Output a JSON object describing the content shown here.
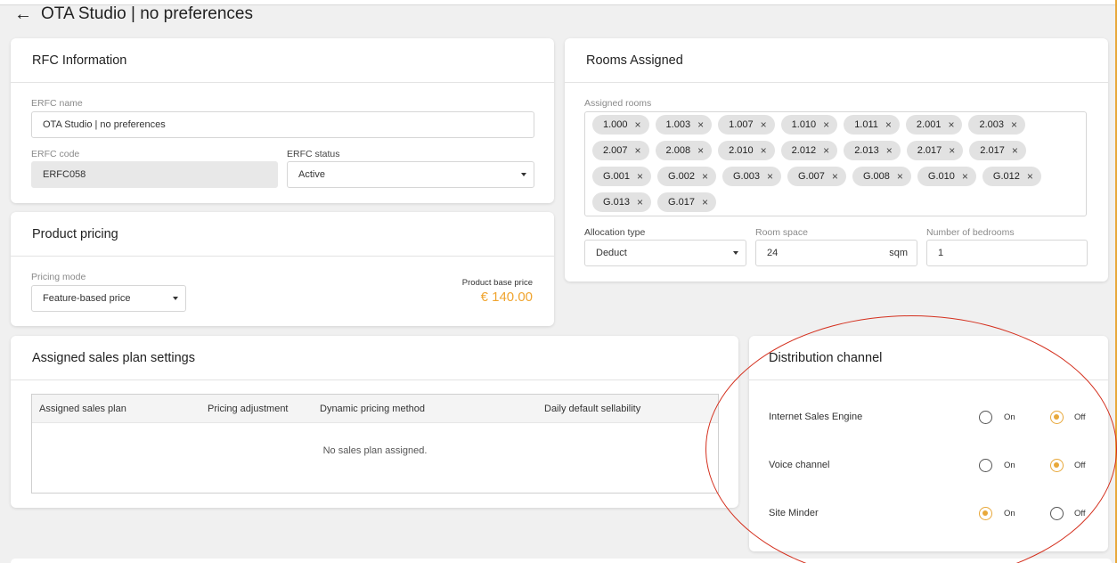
{
  "header": {
    "back_icon": "arrow-left-icon",
    "title": "OTA Studio | no preferences"
  },
  "rfc": {
    "title": "RFC Information",
    "name_label": "ERFC name",
    "name_value": "OTA Studio | no preferences",
    "code_label": "ERFC code",
    "code_value": "ERFC058",
    "status_label": "ERFC status",
    "status_value": "Active"
  },
  "pricing": {
    "title": "Product pricing",
    "mode_label": "Pricing mode",
    "mode_value": "Feature-based price",
    "base_price_label": "Product base price",
    "base_price_value": "€ 140.00"
  },
  "rooms": {
    "title": "Rooms Assigned",
    "assigned_label": "Assigned rooms",
    "chips": [
      "1.000",
      "1.003",
      "1.007",
      "1.010",
      "1.011",
      "2.001",
      "2.003",
      "2.007",
      "2.008",
      "2.010",
      "2.012",
      "2.013",
      "2.017",
      "2.017",
      "G.001",
      "G.002",
      "G.003",
      "G.007",
      "G.008",
      "G.010",
      "G.012",
      "G.013",
      "G.017"
    ],
    "chip_remove_glyph": "×",
    "allocation_label": "Allocation type",
    "allocation_value": "Deduct",
    "space_label": "Room space",
    "space_value": "24",
    "space_unit": "sqm",
    "bedrooms_label": "Number of bedrooms",
    "bedrooms_value": "1"
  },
  "sales": {
    "title": "Assigned sales plan settings",
    "columns": [
      "Assigned sales plan",
      "Pricing adjustment",
      "Dynamic pricing method",
      "Daily default sellability"
    ],
    "empty_message": "No sales plan assigned."
  },
  "distribution": {
    "title": "Distribution channel",
    "on_label": "On",
    "off_label": "Off",
    "channels": [
      {
        "name": "Internet Sales Engine",
        "state": "off"
      },
      {
        "name": "Voice channel",
        "state": "off"
      },
      {
        "name": "Site Minder",
        "state": "on"
      }
    ]
  },
  "colors": {
    "accent": "#e8a83a",
    "price": "#f0a530",
    "annotation": "#d4301e"
  }
}
